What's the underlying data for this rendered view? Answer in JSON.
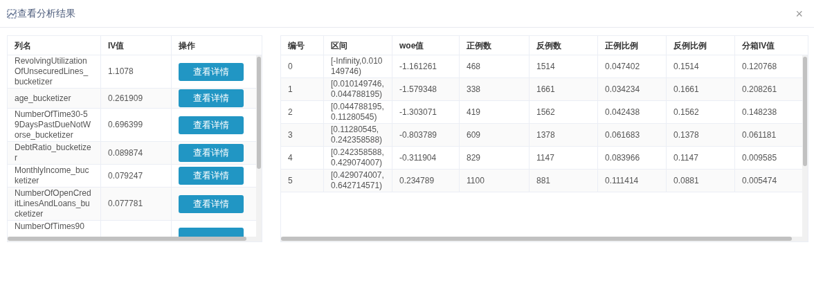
{
  "window": {
    "title": "查看分析结果",
    "close": "×"
  },
  "left_table": {
    "columns": [
      {
        "label": "列名",
        "kind": "text"
      },
      {
        "label": "IV值",
        "kind": "text"
      },
      {
        "label": "操作",
        "kind": "button"
      }
    ],
    "rows": [
      {
        "cells": [
          "RevolvingUtilizationOfUnsecuredLines_bucketizer",
          "1.1078",
          "查看详情"
        ]
      },
      {
        "cells": [
          "age_bucketizer",
          "0.261909",
          "查看详情"
        ]
      },
      {
        "cells": [
          "NumberOfTime30-59DaysPastDueNotWorse_bucketizer",
          "0.696399",
          "查看详情"
        ]
      },
      {
        "cells": [
          "DebtRatio_bucketizer",
          "0.089874",
          "查看详情"
        ]
      },
      {
        "cells": [
          "MonthlyIncome_bucketizer",
          "0.079247",
          "查看详情"
        ]
      },
      {
        "cells": [
          "NumberOfOpenCreditLinesAndLoans_bucketizer",
          "0.077781",
          "查看详情"
        ]
      },
      {
        "cells": [
          "NumberOfTimes90",
          null,
          null
        ]
      }
    ]
  },
  "right_table": {
    "columns": [
      {
        "label": "编号",
        "kind": "text"
      },
      {
        "label": "区间",
        "kind": "text"
      },
      {
        "label": "woe值",
        "kind": "text"
      },
      {
        "label": "正例数",
        "kind": "text"
      },
      {
        "label": "反例数",
        "kind": "text"
      },
      {
        "label": "正例比例",
        "kind": "text"
      },
      {
        "label": "反例比例",
        "kind": "text"
      },
      {
        "label": "分箱IV值",
        "kind": "text"
      }
    ],
    "rows": [
      {
        "cells": [
          "0",
          "[-Infinity,0.010149746)",
          "-1.161261",
          "468",
          "1514",
          "0.047402",
          "0.1514",
          "0.120768"
        ]
      },
      {
        "cells": [
          "1",
          "[0.010149746,0.044788195)",
          "-1.579348",
          "338",
          "1661",
          "0.034234",
          "0.1661",
          "0.208261"
        ]
      },
      {
        "cells": [
          "2",
          "[0.044788195,0.11280545)",
          "-1.303071",
          "419",
          "1562",
          "0.042438",
          "0.1562",
          "0.148238"
        ]
      },
      {
        "cells": [
          "3",
          "[0.11280545, 0.242358588)",
          "-0.803789",
          "609",
          "1378",
          "0.061683",
          "0.1378",
          "0.061181"
        ]
      },
      {
        "cells": [
          "4",
          "[0.242358588,0.429074007)",
          "-0.311904",
          "829",
          "1147",
          "0.083966",
          "0.1147",
          "0.009585"
        ]
      },
      {
        "cells": [
          "5",
          "[0.429074007,0.642714571)",
          "0.234789",
          "1100",
          "881",
          "0.111414",
          "0.0881",
          "0.005474"
        ]
      }
    ]
  }
}
